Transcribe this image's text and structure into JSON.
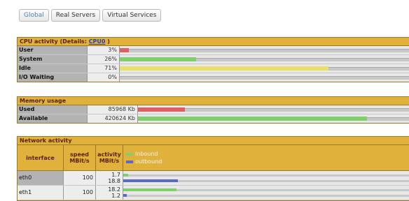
{
  "tabs": [
    {
      "label": "Global",
      "active": true
    },
    {
      "label": "Real Servers",
      "active": false
    },
    {
      "label": "Virtual Services",
      "active": false
    }
  ],
  "cpu": {
    "title": "CPU activity (Details: ",
    "details_link": "CPU0",
    "title_suffix": " )",
    "rows": [
      {
        "label": "User",
        "value": "3%",
        "fraction": 0.03,
        "color": "#e06060"
      },
      {
        "label": "System",
        "value": "26%",
        "fraction": 0.26,
        "color": "#7fcf6a"
      },
      {
        "label": "Idle",
        "value": "71%",
        "fraction": 0.71,
        "color": "#e7e06a"
      },
      {
        "label": "I/O Waiting",
        "value": "0%",
        "fraction": 0.0,
        "color": "#e06060"
      }
    ]
  },
  "memory": {
    "title": "Memory usage",
    "rows": [
      {
        "label": "Used",
        "value": "85968 Kb",
        "fraction": 0.17,
        "color": "#e06060"
      },
      {
        "label": "Available",
        "value": "420624 Kb",
        "fraction": 0.83,
        "color": "#7fcf6a"
      }
    ]
  },
  "network": {
    "title": "Network activity",
    "headers": {
      "interface": "interface",
      "speed": "speed\nMBit/s",
      "activity": "activity\nMBit/s"
    },
    "legend": [
      {
        "label": "inbound",
        "color": "#7fcf6a"
      },
      {
        "label": "outbound",
        "color": "#5a6ac0"
      }
    ],
    "rows": [
      {
        "iface": "eth0",
        "speed": "100",
        "inbound": "1.7",
        "outbound": "18.8",
        "in_frac": 0.017,
        "out_frac": 0.188
      },
      {
        "iface": "eth1",
        "speed": "100",
        "inbound": "18.2",
        "outbound": "1.2",
        "in_frac": 0.182,
        "out_frac": 0.012
      }
    ]
  }
}
